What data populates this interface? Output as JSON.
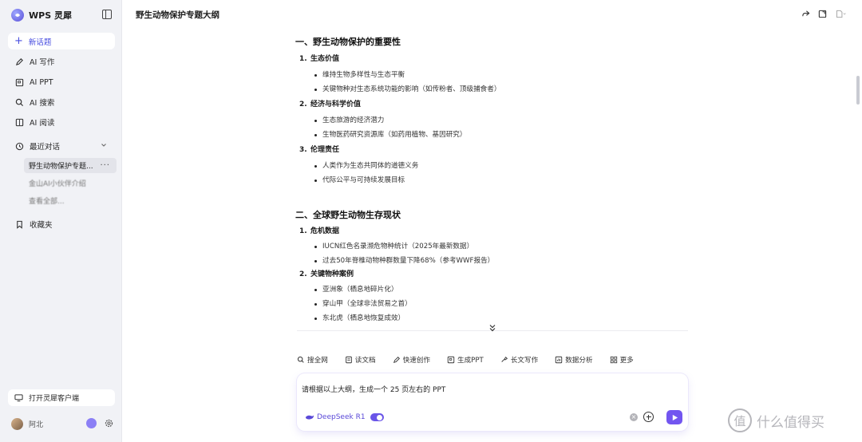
{
  "brand": {
    "name": "WPS 灵犀"
  },
  "sidebar": {
    "new_chat": "新话题",
    "items": [
      {
        "label": "AI 写作",
        "icon": "pen-icon"
      },
      {
        "label": "AI PPT",
        "icon": "ppt-icon"
      },
      {
        "label": "AI 搜索",
        "icon": "search-icon"
      },
      {
        "label": "AI 阅读",
        "icon": "book-icon"
      }
    ],
    "recent": {
      "label": "最近对话",
      "items": [
        {
          "label": "野生动物保护专题...",
          "active": true
        },
        {
          "label": "金山AI小伙伴介绍",
          "active": false
        },
        {
          "label": "查看全部...",
          "active": false
        }
      ]
    },
    "favorites": "收藏夹",
    "open_client": "打开灵犀客户端",
    "user_name": "阿北"
  },
  "doc": {
    "title": "野生动物保护专题大纲",
    "sections": [
      {
        "heading": "一、野生动物保护的重要性",
        "items": [
          {
            "num": "1.",
            "title": "生态价值",
            "bullets": [
              "维持生物多样性与生态平衡",
              "关键物种对生态系统功能的影响（如传粉者、顶级捕食者）"
            ]
          },
          {
            "num": "2.",
            "title": "经济与科学价值",
            "bullets": [
              "生态旅游的经济潜力",
              "生物医药研究资源库（如药用植物、基因研究）"
            ]
          },
          {
            "num": "3.",
            "title": "伦理责任",
            "bullets": [
              "人类作为生态共同体的道德义务",
              "代际公平与可持续发展目标"
            ]
          }
        ]
      },
      {
        "heading": "二、全球野生动物生存现状",
        "items": [
          {
            "num": "1.",
            "title": "危机数据",
            "bullets": [
              "IUCN红色名录濒危物种统计（2025年最新数据）",
              "过去50年脊椎动物种群数量下降68%（参考WWF报告）"
            ]
          },
          {
            "num": "2.",
            "title": "关键物种案例",
            "bullets": [
              "亚洲象（栖息地碎片化）",
              "穿山甲（全球非法贸易之首）",
              "东北虎（栖息地恢复成效）"
            ]
          }
        ]
      }
    ]
  },
  "toolbar": [
    {
      "label": "搜全网",
      "icon": "search-icon"
    },
    {
      "label": "读文档",
      "icon": "doc-icon"
    },
    {
      "label": "快速创作",
      "icon": "pen-icon"
    },
    {
      "label": "生成PPT",
      "icon": "ppt-icon"
    },
    {
      "label": "长文写作",
      "icon": "write-icon"
    },
    {
      "label": "数据分析",
      "icon": "chart-icon"
    },
    {
      "label": "更多",
      "icon": "grid-icon"
    }
  ],
  "input": {
    "value": "请根据以上大纲，生成一个 25 页左右的 PPT",
    "model": "DeepSeek R1"
  },
  "watermark": {
    "logo": "值",
    "text": "什么值得买"
  },
  "colors": {
    "accent": "#7255f0",
    "sidebar_bg": "#f1f2f6"
  }
}
